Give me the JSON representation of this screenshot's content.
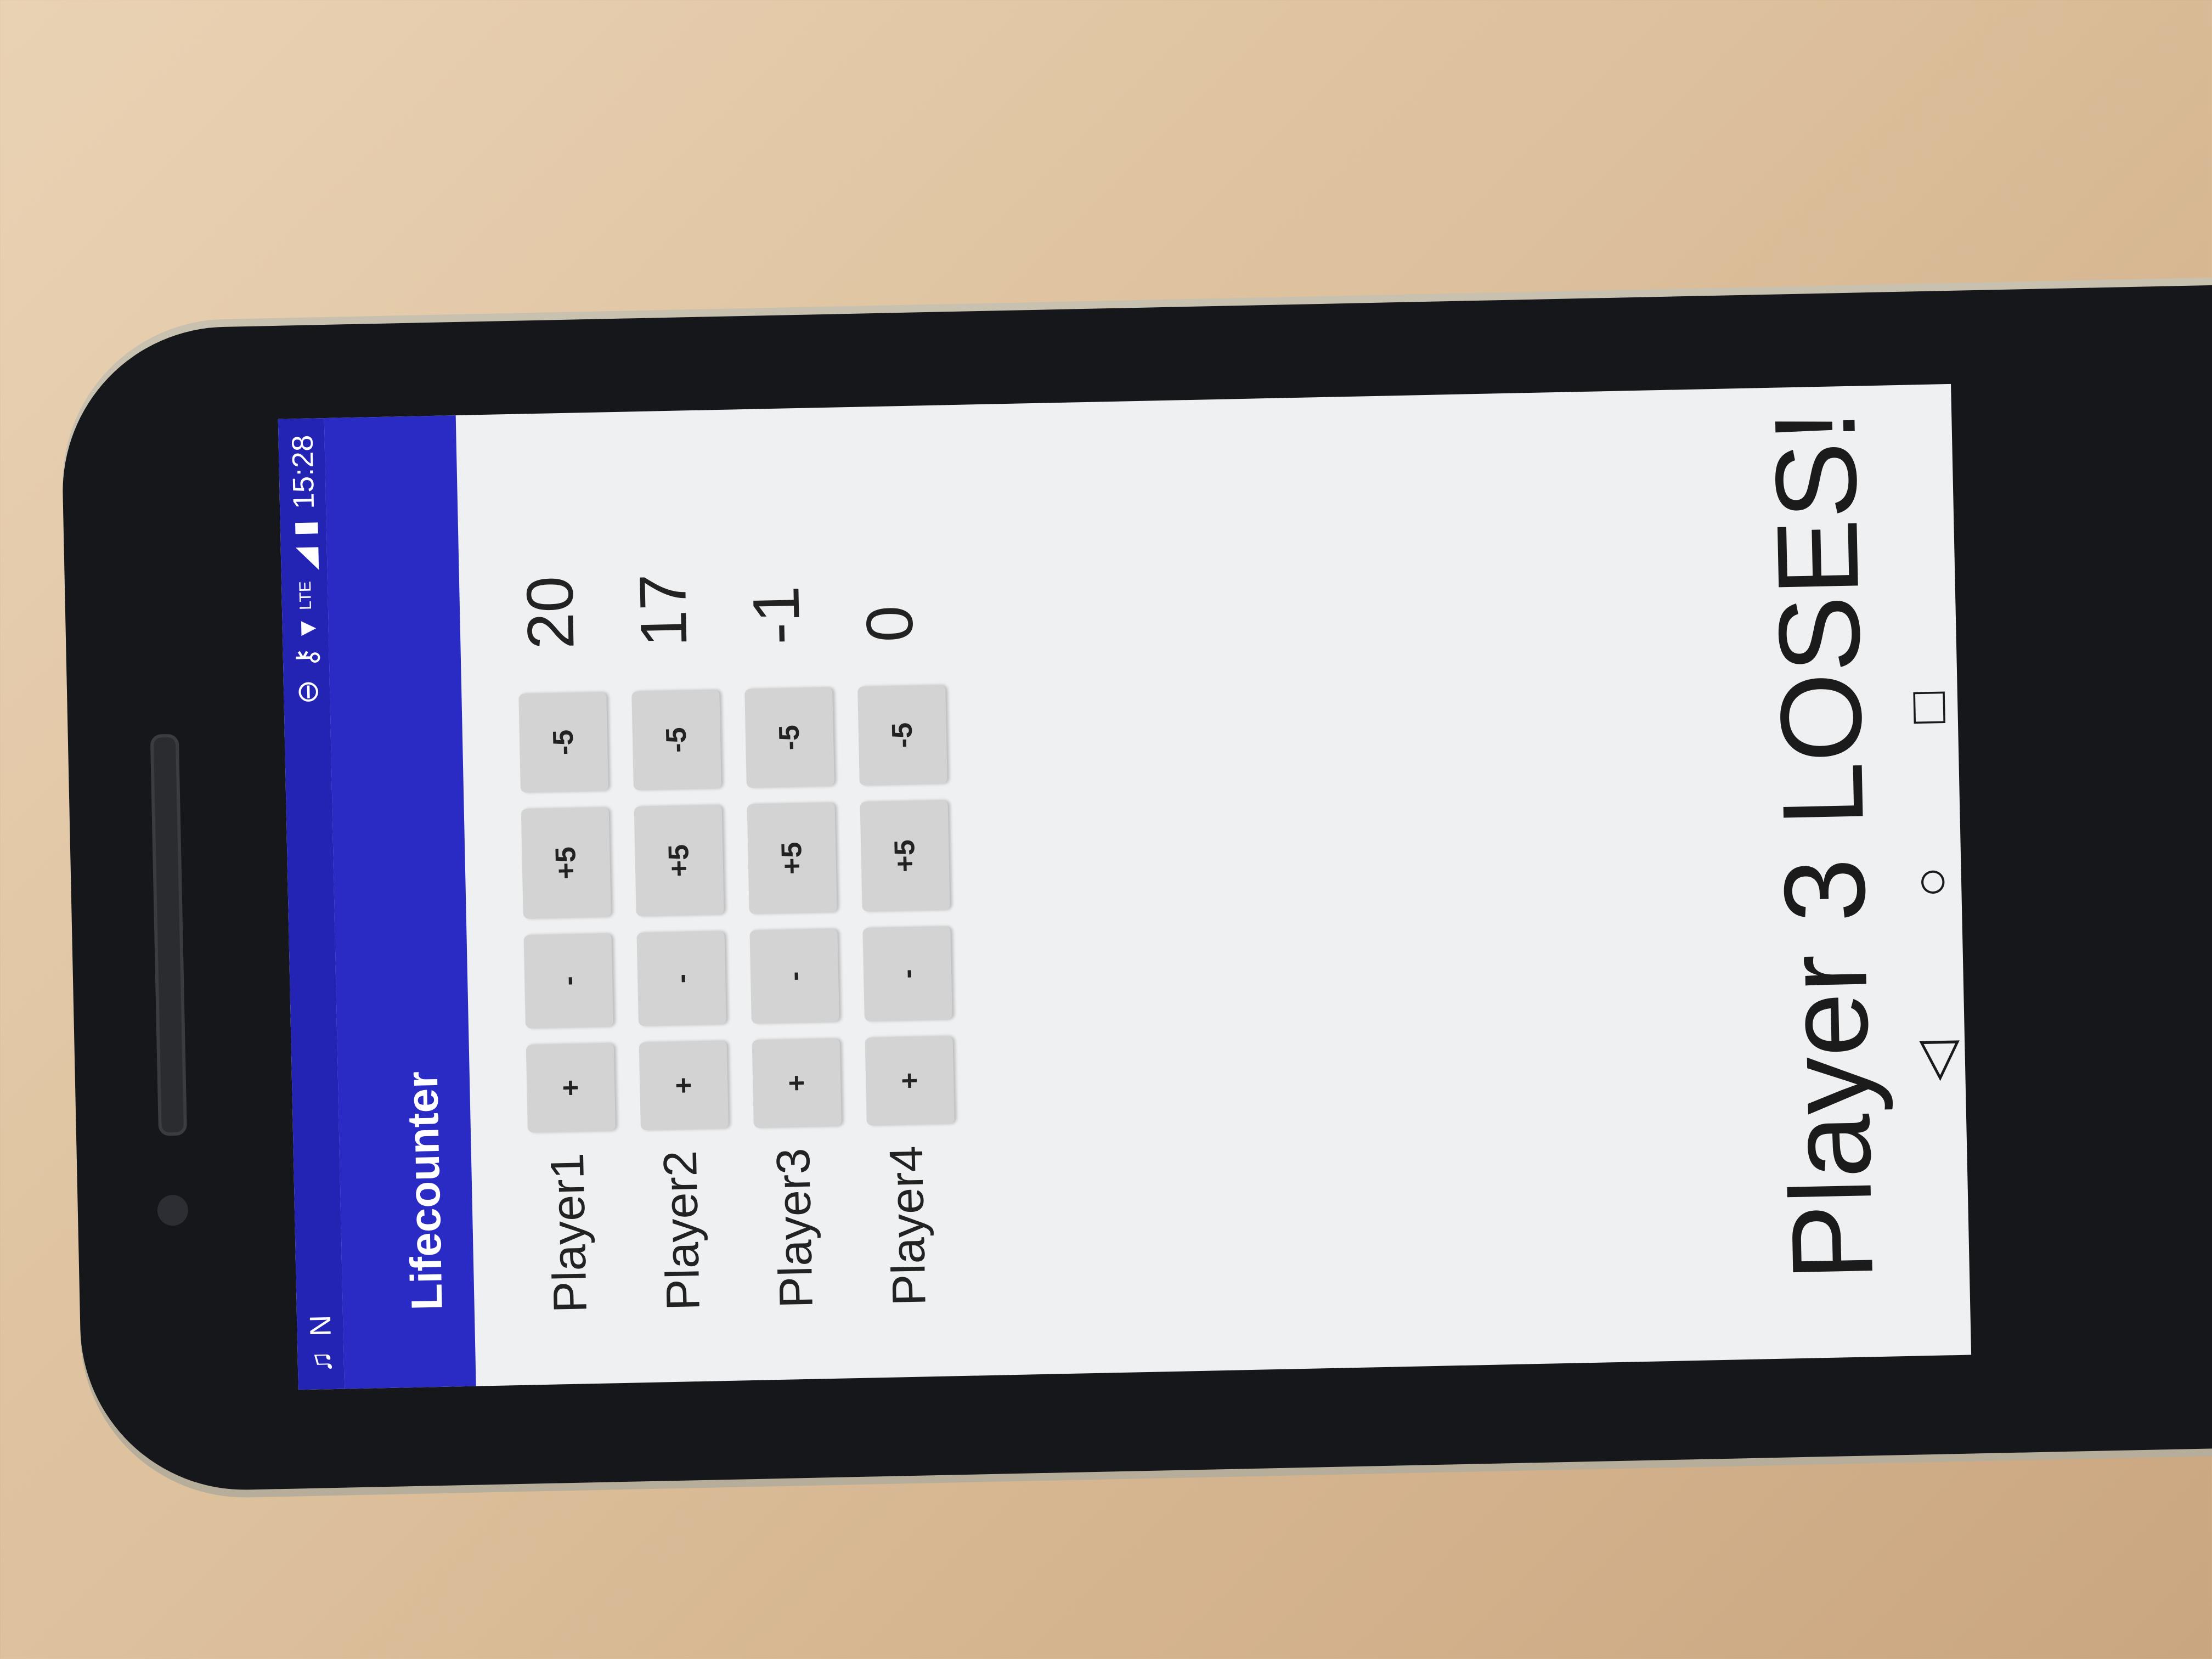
{
  "app": {
    "title": "Lifecounter"
  },
  "statusbar": {
    "left_icons": [
      "music-note-icon",
      "n-icon"
    ],
    "right_icons": [
      "minus-circle-icon",
      "key-icon",
      "wifi-icon",
      "lte-icon",
      "signal-icon",
      "battery-icon"
    ],
    "time": "15:28"
  },
  "players": [
    {
      "name": "Player1",
      "life": "20"
    },
    {
      "name": "Player2",
      "life": "17"
    },
    {
      "name": "Player3",
      "life": "-1"
    },
    {
      "name": "Player4",
      "life": "0"
    }
  ],
  "buttons": {
    "plus": "+",
    "minus": "-",
    "plus5": "+5",
    "minus5": "-5"
  },
  "message": "Player 3 LOSES!",
  "nav": {
    "back": "◁",
    "home": "○",
    "recents": "□"
  },
  "colors": {
    "statusbar": "#2323b4",
    "appbar": "#2a2bc4",
    "button": "#d3d3d3"
  }
}
